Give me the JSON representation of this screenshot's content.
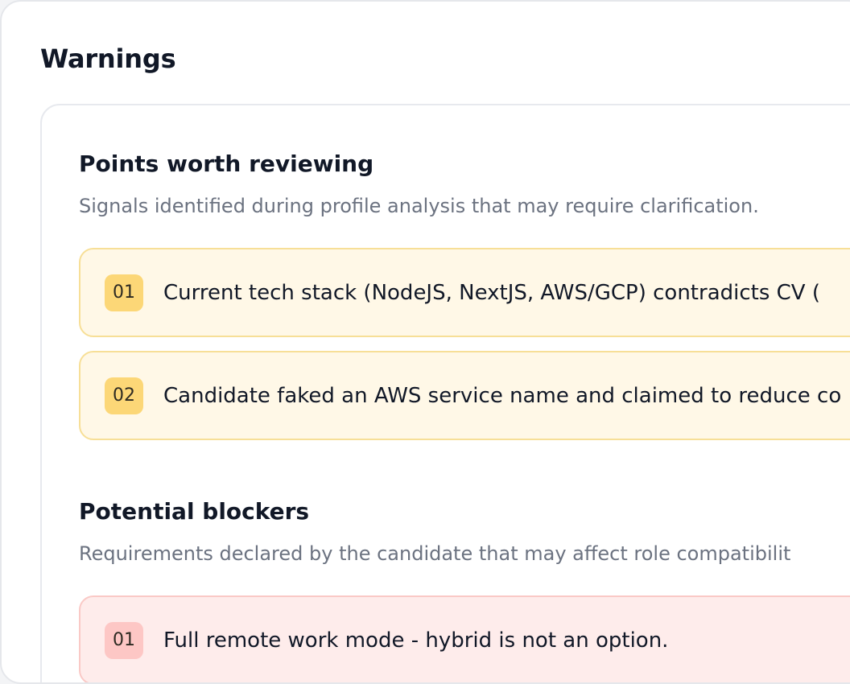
{
  "page": {
    "title": "Warnings"
  },
  "points_worth_reviewing": {
    "title": "Points worth reviewing",
    "description": "Signals identified during profile analysis that may require clarification.",
    "items": [
      {
        "number": "01",
        "text": "Current tech stack (NodeJS, NextJS, AWS/GCP) contradicts CV (",
        "severity_color": "#f7df97"
      },
      {
        "number": "02",
        "text": "Candidate faked an AWS service name and claimed to reduce co",
        "severity_color": "#f7df97"
      }
    ]
  },
  "potential_blockers": {
    "title": "Potential blockers",
    "description": "Requirements declared by the candidate that may affect role compatibilit",
    "items": [
      {
        "number": "01",
        "text": "Full remote work mode - hybrid is not an option.",
        "severity_color": "#fac9c6"
      }
    ]
  }
}
